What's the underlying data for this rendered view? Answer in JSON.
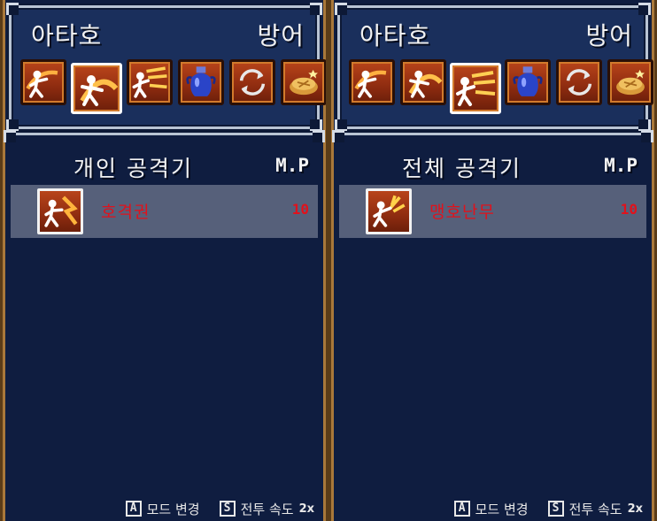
{
  "panels": [
    {
      "character": "아타호",
      "command": "방어",
      "list_title": "개인 공격기",
      "mp_header": "M.P",
      "selected_icon": 1,
      "skills": [
        {
          "name": "호격권",
          "mp": "10",
          "icon": "fist-strike-icon"
        }
      ],
      "footer": {
        "mode_key": "A",
        "mode_label": "모드 변경",
        "speed_key": "S",
        "speed_label": "전투 속도",
        "speed_value": "2x"
      }
    },
    {
      "character": "아타호",
      "command": "방어",
      "list_title": "전체 공격기",
      "mp_header": "M.P",
      "selected_icon": 2,
      "skills": [
        {
          "name": "맹호난무",
          "mp": "10",
          "icon": "tiger-dance-icon"
        }
      ],
      "footer": {
        "mode_key": "A",
        "mode_label": "모드 변경",
        "speed_key": "S",
        "speed_label": "전투 속도",
        "speed_value": "2x"
      }
    }
  ],
  "command_icons": [
    "punch-attack-icon",
    "single-attack-skill-icon",
    "all-attack-skill-icon",
    "item-vase-icon",
    "swap-cycle-icon",
    "food-icon"
  ],
  "colors": {
    "skill_name": "#e0121c",
    "selected_row": "#56607a",
    "window_bg": "#0f1d40"
  }
}
